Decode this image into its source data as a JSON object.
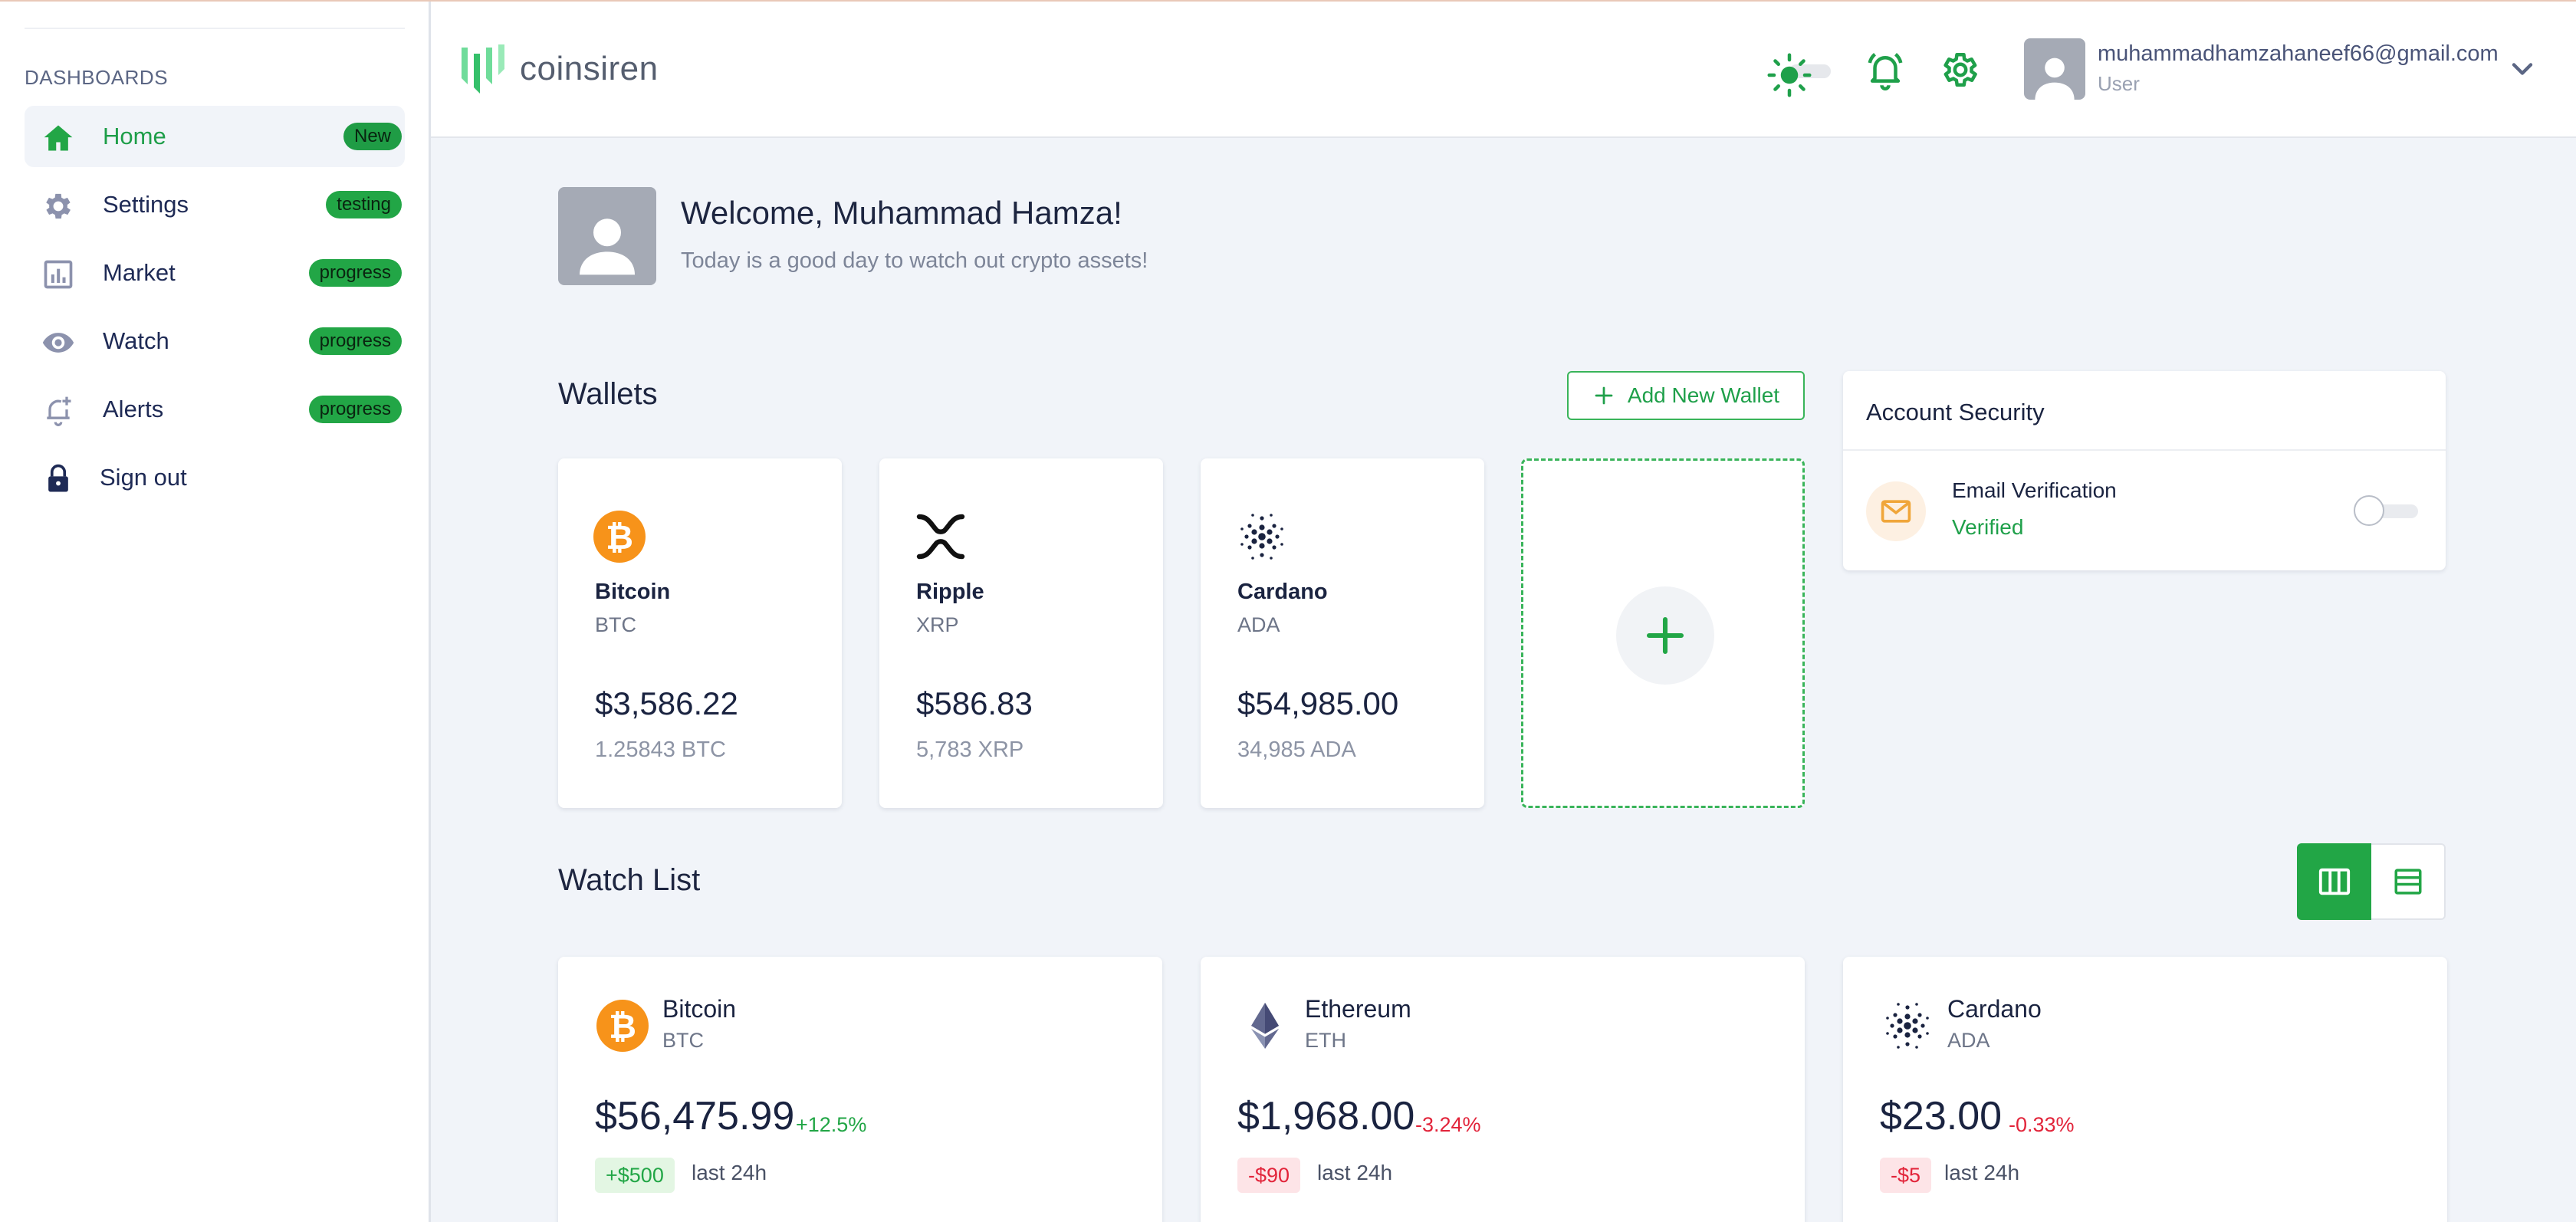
{
  "app": {
    "name": "coinsiren"
  },
  "colors": {
    "accent": "#22a646",
    "negative": "#e2243a",
    "bitcoin": "#f7931a"
  },
  "sidebar": {
    "section_title": "DASHBOARDS",
    "items": [
      {
        "label": "Home",
        "badge": "New",
        "icon": "home-icon",
        "active": true
      },
      {
        "label": "Settings",
        "badge": "testing",
        "icon": "gear-icon"
      },
      {
        "label": "Market",
        "badge": "progress",
        "icon": "chart-icon"
      },
      {
        "label": "Watch",
        "badge": "progress",
        "icon": "eye-icon"
      },
      {
        "label": "Alerts",
        "badge": "progress",
        "icon": "bell-plus-icon"
      },
      {
        "label": "Sign out",
        "badge": "",
        "icon": "lock-icon"
      }
    ]
  },
  "header": {
    "user_email": "muhammadhamzahaneef66@gmail.com",
    "user_role": "User",
    "icons": [
      "sun-icon",
      "bell-icon",
      "gear-icon",
      "chevron-down-icon"
    ]
  },
  "welcome": {
    "title": "Welcome, Muhammad Hamza!",
    "subtitle": "Today is a good day to watch out crypto assets!"
  },
  "wallets": {
    "heading": "Wallets",
    "add_button": "Add New Wallet",
    "cards": [
      {
        "name": "Bitcoin",
        "symbol": "BTC",
        "value": "$3,586.22",
        "amount": "1.25843 BTC",
        "icon": "bitcoin-icon"
      },
      {
        "name": "Ripple",
        "symbol": "XRP",
        "value": "$586.83",
        "amount": "5,783 XRP",
        "icon": "ripple-icon"
      },
      {
        "name": "Cardano",
        "symbol": "ADA",
        "value": "$54,985.00",
        "amount": "34,985 ADA",
        "icon": "cardano-icon"
      }
    ]
  },
  "security": {
    "title": "Account Security",
    "email_verification": "Email Verification",
    "status": "Verified"
  },
  "watchlist": {
    "heading": "Watch List",
    "cards": [
      {
        "name": "Bitcoin",
        "symbol": "BTC",
        "price": "$56,475.99",
        "change_pct": "+12.5%",
        "change_abs": "+$500",
        "period": "last 24h",
        "trend": "up",
        "icon": "bitcoin-icon"
      },
      {
        "name": "Ethereum",
        "symbol": "ETH",
        "price": "$1,968.00",
        "change_pct": "-3.24%",
        "change_abs": "-$90",
        "period": "last 24h",
        "trend": "down",
        "icon": "ethereum-icon"
      },
      {
        "name": "Cardano",
        "symbol": "ADA",
        "price": "$23.00",
        "change_pct": "-0.33%",
        "change_abs": "-$5",
        "period": "last 24h",
        "trend": "down",
        "icon": "cardano-icon"
      }
    ]
  }
}
